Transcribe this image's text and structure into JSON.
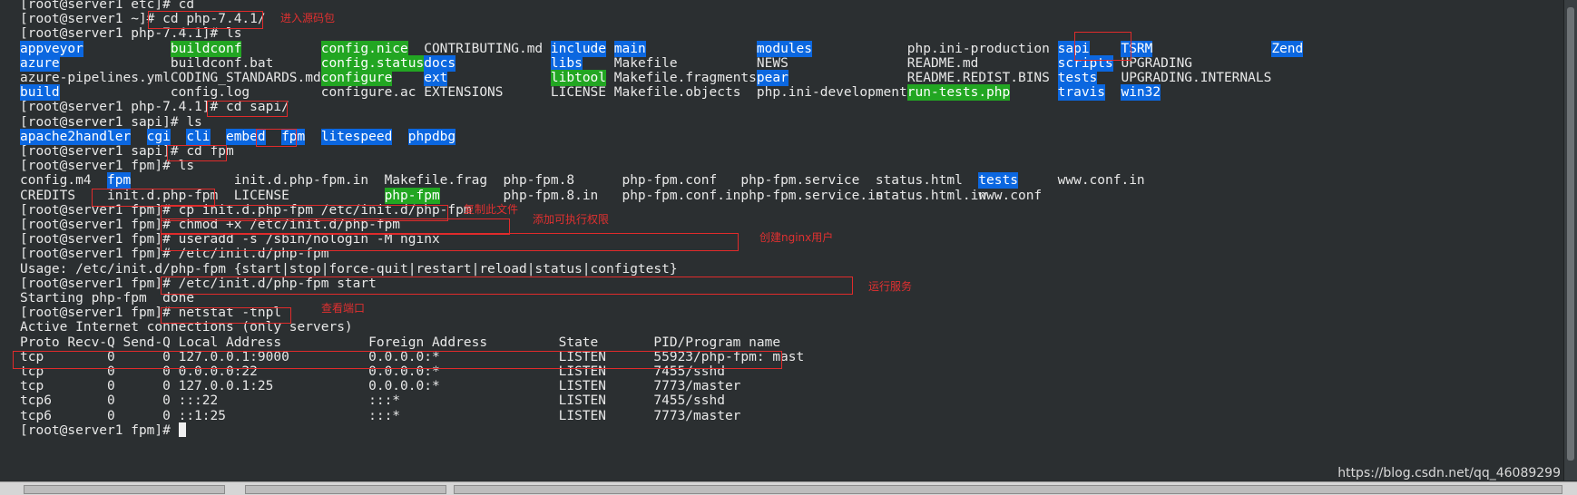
{
  "terminal": {
    "lines": [
      {
        "segments": [
          {
            "text": "[root@server1 etc]# cd"
          }
        ]
      },
      {
        "segments": [
          {
            "text": "[root@server1 ~]# cd php-7.4.1/"
          }
        ]
      },
      {
        "segments": [
          {
            "text": "[root@server1 php-7.4.1]# ls"
          }
        ]
      },
      {
        "segments": [
          {
            "text": "appveyor",
            "col": 0,
            "type": "dir"
          },
          {
            "text": "buildconf",
            "col": 19,
            "type": "exe"
          },
          {
            "text": "config.nice",
            "col": 38,
            "type": "exe"
          },
          {
            "text": "CONTRIBUTING.md",
            "col": 51
          },
          {
            "text": "include",
            "col": 67,
            "type": "dir"
          },
          {
            "text": "main",
            "col": 75,
            "type": "dir"
          },
          {
            "text": "modules",
            "col": 93,
            "type": "dir"
          },
          {
            "text": "php.ini-production",
            "col": 112
          },
          {
            "text": "sapi",
            "col": 131,
            "type": "dir"
          },
          {
            "text": "TSRM",
            "col": 139,
            "type": "dir"
          },
          {
            "text": "Zend",
            "col": 158,
            "type": "dir"
          }
        ]
      },
      {
        "segments": [
          {
            "text": "azure",
            "col": 0,
            "type": "dir"
          },
          {
            "text": "buildconf.bat",
            "col": 19
          },
          {
            "text": "config.status",
            "col": 38,
            "type": "exe"
          },
          {
            "text": "docs",
            "col": 51,
            "type": "dir"
          },
          {
            "text": "libs",
            "col": 67,
            "type": "dir"
          },
          {
            "text": "Makefile",
            "col": 75
          },
          {
            "text": "NEWS",
            "col": 93
          },
          {
            "text": "README.md",
            "col": 112
          },
          {
            "text": "scripts",
            "col": 131,
            "type": "dir"
          },
          {
            "text": "UPGRADING",
            "col": 139
          }
        ]
      },
      {
        "segments": [
          {
            "text": "azure-pipelines.yml",
            "col": 0
          },
          {
            "text": "CODING_STANDARDS.md",
            "col": 19
          },
          {
            "text": "configure",
            "col": 38,
            "type": "exe"
          },
          {
            "text": "ext",
            "col": 51,
            "type": "dir"
          },
          {
            "text": "libtool",
            "col": 67,
            "type": "exe"
          },
          {
            "text": "Makefile.fragments",
            "col": 75
          },
          {
            "text": "pear",
            "col": 93,
            "type": "dir"
          },
          {
            "text": "README.REDIST.BINS",
            "col": 112
          },
          {
            "text": "tests",
            "col": 131,
            "type": "dir"
          },
          {
            "text": "UPGRADING.INTERNALS",
            "col": 139
          }
        ]
      },
      {
        "segments": [
          {
            "text": "build",
            "col": 0,
            "type": "dir"
          },
          {
            "text": "config.log",
            "col": 19
          },
          {
            "text": "configure.ac",
            "col": 38
          },
          {
            "text": "EXTENSIONS",
            "col": 51
          },
          {
            "text": "LICENSE",
            "col": 67
          },
          {
            "text": "Makefile.objects",
            "col": 75
          },
          {
            "text": "php.ini-development",
            "col": 93
          },
          {
            "text": "run-tests.php",
            "col": 112,
            "type": "exe"
          },
          {
            "text": "travis",
            "col": 131,
            "type": "dir"
          },
          {
            "text": "win32",
            "col": 139,
            "type": "dir"
          }
        ]
      },
      {
        "segments": [
          {
            "text": "[root@server1 php-7.4.1]# cd sapi/"
          }
        ]
      },
      {
        "segments": [
          {
            "text": "[root@server1 sapi]# ls"
          }
        ]
      },
      {
        "segments": [
          {
            "text": "apache2handler",
            "col": 0,
            "type": "dir"
          },
          {
            "text": "cgi",
            "col": 16,
            "type": "dir"
          },
          {
            "text": "cli",
            "col": 21,
            "type": "dir"
          },
          {
            "text": "embed",
            "col": 26,
            "type": "dir"
          },
          {
            "text": "fpm",
            "col": 33,
            "type": "dir"
          },
          {
            "text": "litespeed",
            "col": 38,
            "type": "dir"
          },
          {
            "text": "phpdbg",
            "col": 49,
            "type": "dir"
          }
        ]
      },
      {
        "segments": [
          {
            "text": "[root@server1 sapi]# cd fpm"
          }
        ]
      },
      {
        "segments": [
          {
            "text": "[root@server1 fpm]# ls"
          }
        ]
      },
      {
        "segments": [
          {
            "text": "config.m4",
            "col": 0
          },
          {
            "text": "fpm",
            "col": 11,
            "type": "dir"
          },
          {
            "text": "init.d.php-fpm.in",
            "col": 27
          },
          {
            "text": "Makefile.frag",
            "col": 46
          },
          {
            "text": "php-fpm.8",
            "col": 61
          },
          {
            "text": "php-fpm.conf",
            "col": 76
          },
          {
            "text": "php-fpm.service",
            "col": 91
          },
          {
            "text": "status.html",
            "col": 108
          },
          {
            "text": "tests",
            "col": 121,
            "type": "dir"
          },
          {
            "text": "www.conf.in",
            "col": 131
          }
        ]
      },
      {
        "segments": [
          {
            "text": "CREDITS",
            "col": 0
          },
          {
            "text": "init.d.php-fpm",
            "col": 11
          },
          {
            "text": "LICENSE",
            "col": 27
          },
          {
            "text": "php-fpm",
            "col": 46,
            "type": "exe"
          },
          {
            "text": "php-fpm.8.in",
            "col": 61
          },
          {
            "text": "php-fpm.conf.in",
            "col": 76
          },
          {
            "text": "php-fpm.service.in",
            "col": 91
          },
          {
            "text": "status.html.in",
            "col": 108
          },
          {
            "text": "www.conf",
            "col": 121
          }
        ]
      },
      {
        "segments": [
          {
            "text": "[root@server1 fpm]# cp init.d.php-fpm /etc/init.d/php-fpm"
          }
        ]
      },
      {
        "segments": [
          {
            "text": "[root@server1 fpm]# chmod +x /etc/init.d/php-fpm"
          }
        ]
      },
      {
        "segments": [
          {
            "text": "[root@server1 fpm]# useradd -s /sbin/nologin -M nginx"
          }
        ]
      },
      {
        "segments": [
          {
            "text": "[root@server1 fpm]# /etc/init.d/php-fpm"
          }
        ]
      },
      {
        "segments": [
          {
            "text": "Usage: /etc/init.d/php-fpm {start|stop|force-quit|restart|reload|status|configtest}"
          }
        ]
      },
      {
        "segments": [
          {
            "text": "[root@server1 fpm]# /etc/init.d/php-fpm start"
          }
        ]
      },
      {
        "segments": [
          {
            "text": "Starting php-fpm  done"
          }
        ]
      },
      {
        "segments": [
          {
            "text": "[root@server1 fpm]# netstat -tnpl"
          }
        ]
      },
      {
        "segments": [
          {
            "text": "Active Internet connections (only servers)"
          }
        ]
      },
      {
        "segments": [
          {
            "text": "Proto Recv-Q Send-Q Local Address           Foreign Address         State       PID/Program name"
          }
        ]
      },
      {
        "segments": [
          {
            "text": "tcp        0      0 127.0.0.1:9000          0.0.0.0:*               LISTEN      55923/php-fpm: mast"
          }
        ]
      },
      {
        "segments": [
          {
            "text": "tcp        0      0 0.0.0.0:22              0.0.0.0:*               LISTEN      7455/sshd"
          }
        ]
      },
      {
        "segments": [
          {
            "text": "tcp        0      0 127.0.0.1:25            0.0.0.0:*               LISTEN      7773/master"
          }
        ]
      },
      {
        "segments": [
          {
            "text": "tcp6       0      0 :::22                   :::*                    LISTEN      7455/sshd"
          }
        ]
      },
      {
        "segments": [
          {
            "text": "tcp6       0      0 ::1:25                  :::*                    LISTEN      7773/master"
          }
        ]
      },
      {
        "segments": [
          {
            "text": "[root@server1 fpm]# "
          }
        ],
        "cursor": true
      }
    ]
  },
  "annotations": [
    {
      "label": "进入源码包"
    },
    {
      "label": "复制此文件"
    },
    {
      "label": "添加可执行权限"
    },
    {
      "label": "创建nginx用户"
    },
    {
      "label": "运行服务"
    },
    {
      "label": "查看端口"
    }
  ],
  "watermark": "https://blog.csdn.net/qq_46089299",
  "colors": {
    "background": "#2b2f31",
    "text": "#e8e8e8",
    "directory_highlight": "#0b67e0",
    "executable_highlight": "#22a622",
    "annotation_red": "#e02b2b"
  }
}
